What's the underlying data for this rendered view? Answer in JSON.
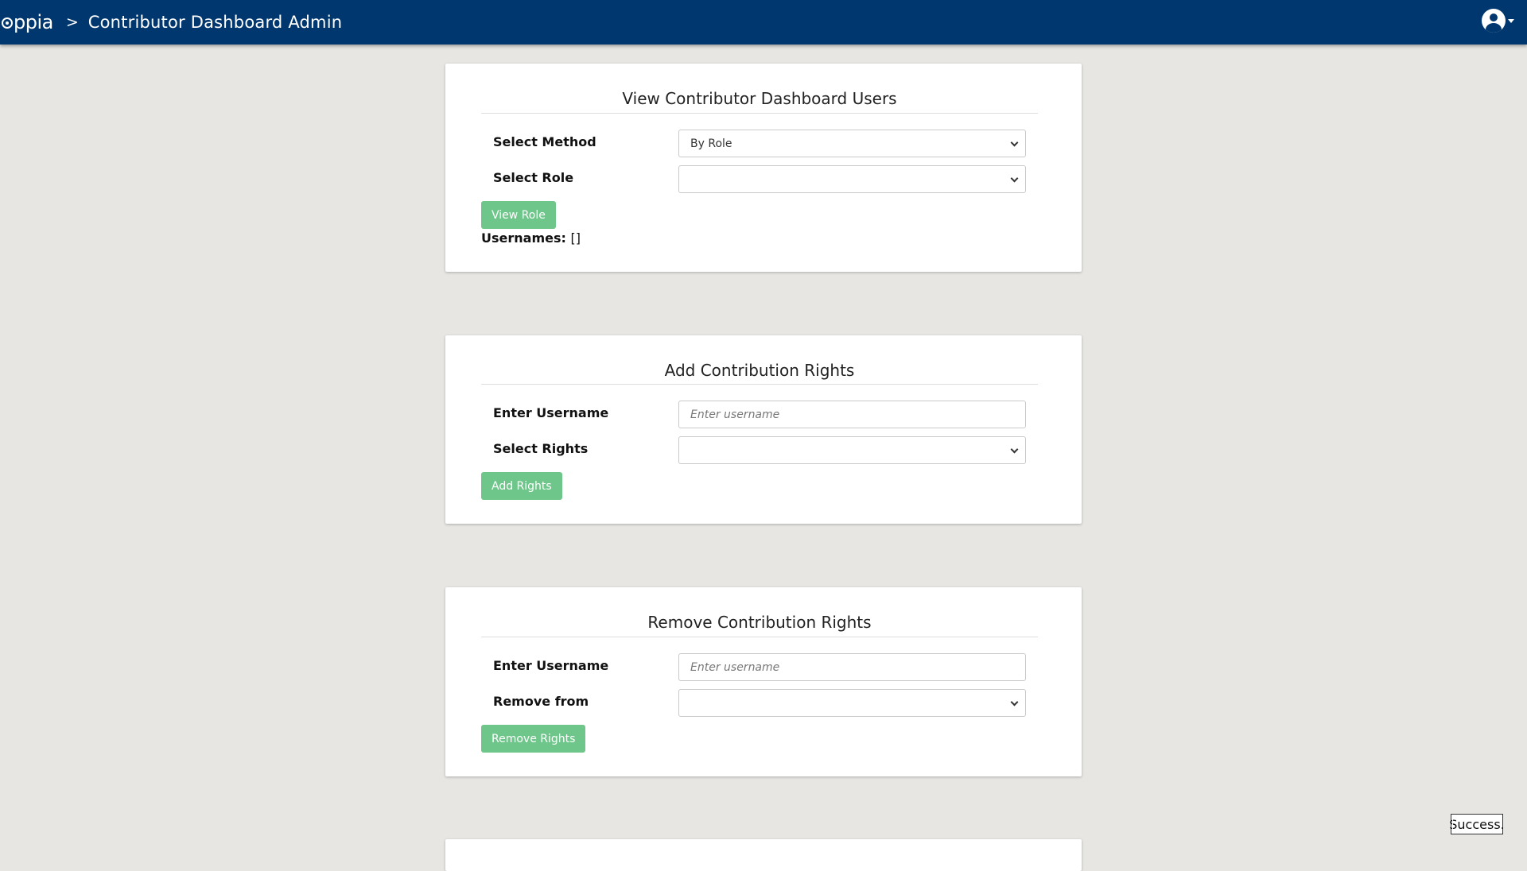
{
  "header": {
    "logo_text": "ppia",
    "separator": ">",
    "page_title": "Contributor Dashboard Admin"
  },
  "view_users": {
    "title": "View Contributor Dashboard Users",
    "method_label": "Select Method",
    "method_value": "By Role",
    "role_label": "Select Role",
    "role_value": "",
    "button_label": "View Role",
    "usernames_label": "Usernames:",
    "usernames_value": "[]"
  },
  "add_rights": {
    "title": "Add Contribution Rights",
    "username_label": "Enter Username",
    "username_placeholder": "Enter username",
    "rights_label": "Select Rights",
    "rights_value": "",
    "button_label": "Add Rights"
  },
  "remove_rights": {
    "title": "Remove Contribution Rights",
    "username_label": "Enter Username",
    "username_placeholder": "Enter username",
    "remove_from_label": "Remove from",
    "remove_from_value": "",
    "button_label": "Remove Rights"
  },
  "toast": {
    "message": "Success."
  },
  "colors": {
    "navbar": "#00376e",
    "background": "#e7e6e3",
    "button": "#6fc68a"
  },
  "icons": [
    "oppia-logo-icon",
    "avatar-icon",
    "chevron-down-icon"
  ]
}
